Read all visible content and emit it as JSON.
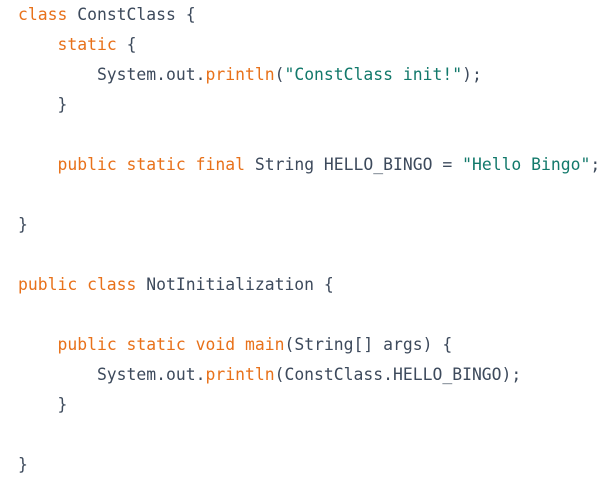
{
  "colors": {
    "keyword": "#e8711a",
    "plain": "#3d4a5c",
    "string": "#12796b"
  },
  "code_lines": [
    [
      {
        "t": "kw",
        "v": "class"
      },
      {
        "t": "plain",
        "v": " ConstClass {"
      }
    ],
    [
      {
        "t": "plain",
        "v": "    "
      },
      {
        "t": "kw",
        "v": "static"
      },
      {
        "t": "plain",
        "v": " {"
      }
    ],
    [
      {
        "t": "plain",
        "v": "        System.out."
      },
      {
        "t": "fn",
        "v": "println"
      },
      {
        "t": "plain",
        "v": "("
      },
      {
        "t": "str",
        "v": "\"ConstClass init!\""
      },
      {
        "t": "plain",
        "v": ");"
      }
    ],
    [
      {
        "t": "plain",
        "v": "    }"
      }
    ],
    [],
    [
      {
        "t": "plain",
        "v": "    "
      },
      {
        "t": "kw",
        "v": "public static final"
      },
      {
        "t": "plain",
        "v": " String HELLO_BINGO = "
      },
      {
        "t": "str",
        "v": "\"Hello Bingo\""
      },
      {
        "t": "plain",
        "v": ";"
      }
    ],
    [],
    [
      {
        "t": "plain",
        "v": "}"
      }
    ],
    [],
    [
      {
        "t": "kw",
        "v": "public class"
      },
      {
        "t": "plain",
        "v": " NotInitialization {"
      }
    ],
    [],
    [
      {
        "t": "plain",
        "v": "    "
      },
      {
        "t": "kw",
        "v": "public static void"
      },
      {
        "t": "plain",
        "v": " "
      },
      {
        "t": "fn",
        "v": "main"
      },
      {
        "t": "plain",
        "v": "(String[] args) {"
      }
    ],
    [
      {
        "t": "plain",
        "v": "        System.out."
      },
      {
        "t": "fn",
        "v": "println"
      },
      {
        "t": "plain",
        "v": "(ConstClass.HELLO_BINGO);"
      }
    ],
    [
      {
        "t": "plain",
        "v": "    }"
      }
    ],
    [],
    [
      {
        "t": "plain",
        "v": "}"
      }
    ]
  ]
}
